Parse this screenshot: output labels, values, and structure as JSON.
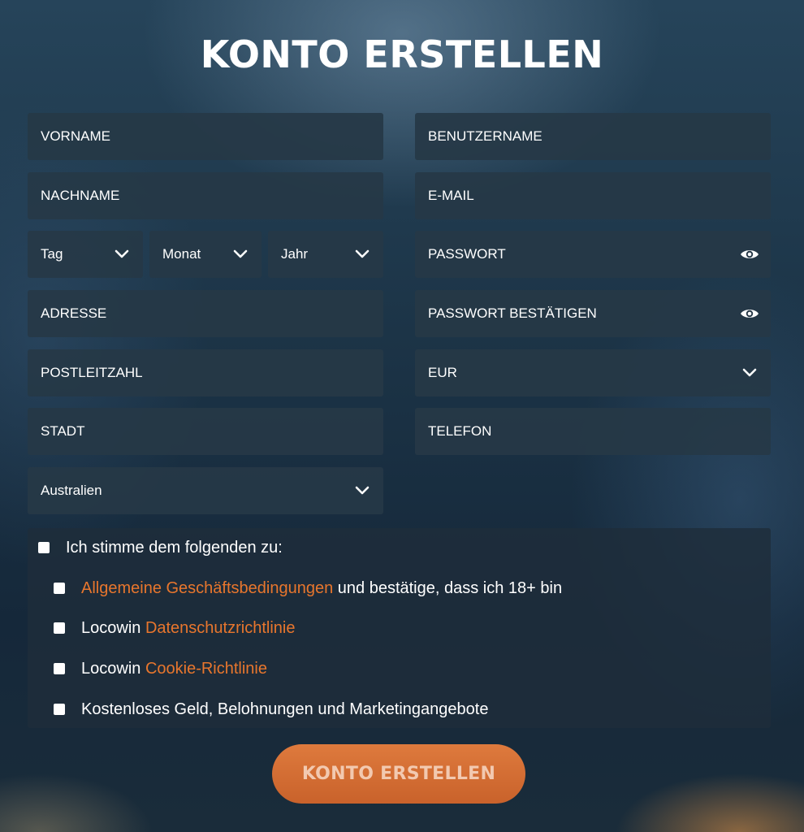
{
  "title": "KONTO ERSTELLEN",
  "form": {
    "vorname": "VORNAME",
    "nachname": "NACHNAME",
    "tag": "Tag",
    "monat": "Monat",
    "jahr": "Jahr",
    "adresse": "ADRESSE",
    "postleitzahl": "POSTLEITZAHL",
    "stadt": "STADT",
    "land": "Australien",
    "benutzername": "BENUTZERNAME",
    "email": "E-MAIL",
    "passwort": "PASSWORT",
    "passwort_bestaetigen": "PASSWORT BESTÄTIGEN",
    "waehrung": "EUR",
    "telefon": "TELEFON"
  },
  "consent": {
    "main": "Ich stimme dem folgenden zu:",
    "terms_link": "Allgemeine Geschäftsbedingungen",
    "terms_rest": " und bestätige, dass ich 18+ bin",
    "privacy_prefix": "Locowin ",
    "privacy_link": "Datenschutzrichtlinie",
    "cookie_prefix": "Locowin ",
    "cookie_link": "Cookie-Richtlinie",
    "marketing": "Kostenloses Geld, Belohnungen und Marketingangebote"
  },
  "submit_label": "KONTO ERSTELLEN",
  "colors": {
    "accent": "#e8762d",
    "field_bg": "#263847"
  }
}
